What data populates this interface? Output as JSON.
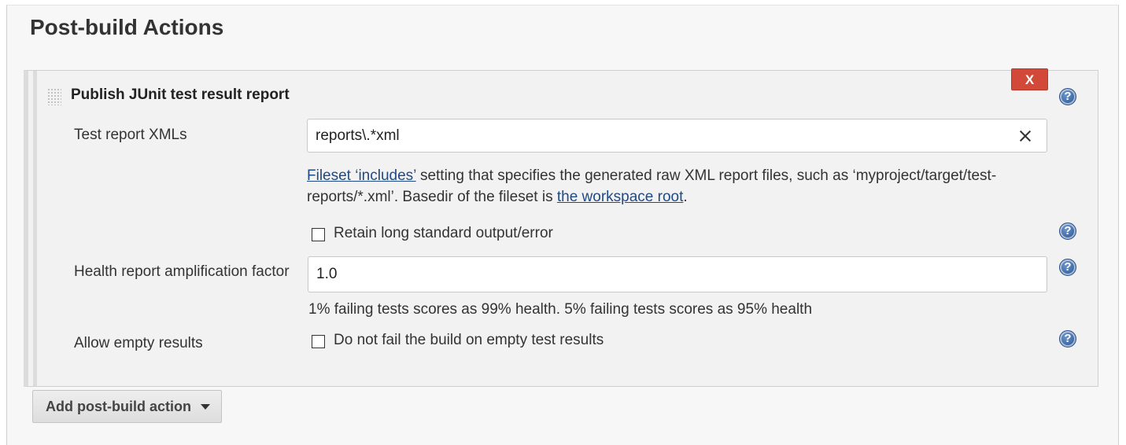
{
  "section": {
    "title": "Post-build Actions"
  },
  "action": {
    "title": "Publish JUnit test result report",
    "delete_label": "X",
    "help_glyph": "?"
  },
  "test_report": {
    "label": "Test report XMLs",
    "value": "reports\\.*xml",
    "help_link_1": "Fileset ‘includes’",
    "help_text_1": " setting that specifies the generated raw XML report files, such as ‘myproject/target/test-reports/*.xml’. Basedir of the fileset is ",
    "help_link_2": "the workspace root",
    "help_text_2": "."
  },
  "retain_output": {
    "label": "Retain long standard output/error",
    "checked": false
  },
  "health_factor": {
    "label": "Health report amplification factor",
    "value": "1.0",
    "help_text": "1% failing tests scores as 99% health. 5% failing tests scores as 95% health"
  },
  "empty_results": {
    "label": "Allow empty results",
    "checkbox_label": "Do not fail the build on empty test results",
    "checked": false
  },
  "add_action": {
    "label": "Add post-build action"
  },
  "colors": {
    "delete_button": "#d24939",
    "link": "#204a87",
    "help_icon": "#3e6aa6"
  }
}
